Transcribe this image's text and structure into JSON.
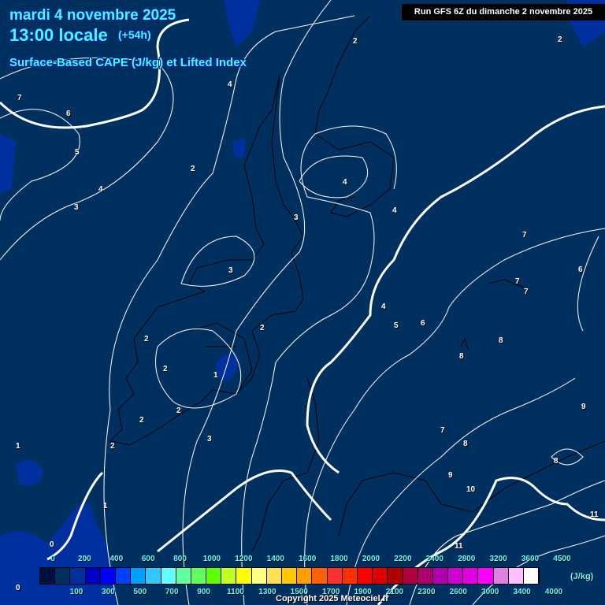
{
  "header": {
    "date": "mardi 4 novembre 2025",
    "time": "13:00 locale",
    "lead": "(+54h)",
    "parameter": "Surface-Based CAPE (J/kg) et Lifted Index",
    "run": "Run GFS 6Z du dimanche 2 novembre 2025"
  },
  "legend": {
    "colors": [
      "#001040",
      "#003060",
      "#0030a0",
      "#0000c8",
      "#0000ff",
      "#0040ff",
      "#00a0ff",
      "#30c8ff",
      "#60ffff",
      "#60ffa0",
      "#60ff60",
      "#60ff00",
      "#c0ff20",
      "#ffff00",
      "#ffff80",
      "#ffe050",
      "#ffc800",
      "#ffa000",
      "#ff6000",
      "#ff3030",
      "#ff3000",
      "#ff0000",
      "#e00000",
      "#b00000",
      "#b00040",
      "#b00070",
      "#b000b0",
      "#d000d0",
      "#e000e0",
      "#ff00ff",
      "#e080e0",
      "#ffc0ff",
      "#ffffff"
    ],
    "top_labels": [
      "0",
      "200",
      "400",
      "600",
      "800",
      "1000",
      "1200",
      "1400",
      "1600",
      "1800",
      "2000",
      "2200",
      "2400",
      "2800",
      "3200",
      "3600",
      "4500"
    ],
    "bottom_labels": [
      "100",
      "300",
      "500",
      "700",
      "900",
      "1100",
      "1300",
      "1500",
      "1700",
      "1900",
      "2100",
      "2300",
      "2600",
      "3000",
      "3400",
      "4000"
    ],
    "unit": "(J/kg)"
  },
  "contour_labels": [
    "2",
    "2",
    "7",
    "6",
    "5",
    "4",
    "2",
    "4",
    "3",
    "4",
    "4",
    "3",
    "7",
    "3",
    "6",
    "7",
    "7",
    "4",
    "5",
    "6",
    "2",
    "2",
    "8",
    "8",
    "2",
    "1",
    "9",
    "2",
    "2",
    "7",
    "3",
    "2",
    "1",
    "8",
    "8",
    "9",
    "10",
    "1",
    "11",
    "0",
    "11",
    "0"
  ],
  "copyright": "Copyright 2025 Meteociel.fr"
}
